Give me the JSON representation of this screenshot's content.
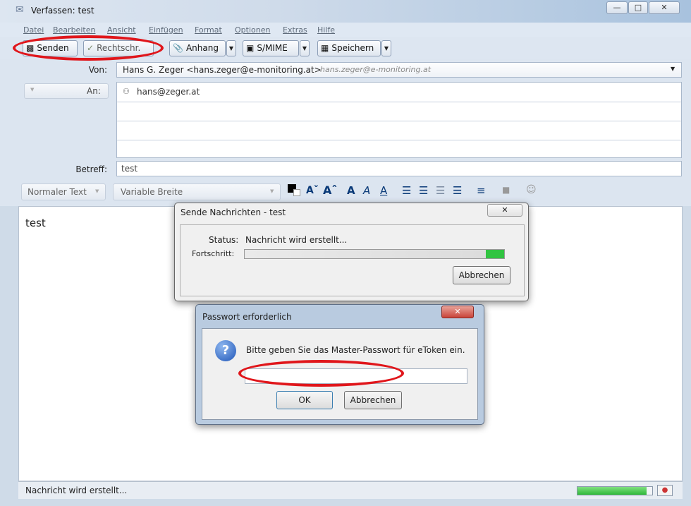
{
  "window": {
    "title": "Verfassen: test"
  },
  "menu": [
    "Datei",
    "Bearbeiten",
    "Ansicht",
    "Einfügen",
    "Format",
    "Optionen",
    "Extras",
    "Hilfe"
  ],
  "toolbar": {
    "send": "Senden",
    "spell": "Rechtschr.",
    "attach": "Anhang",
    "smime": "S/MIME",
    "save": "Speichern"
  },
  "header": {
    "from_label": "Von:",
    "from_value": "Hans G. Zeger <hans.zeger@e-monitoring.at>",
    "from_hint": "hans.zeger@e-monitoring.at",
    "to_label": "An:",
    "to_value": "hans@zeger.at",
    "subject_label": "Betreff:",
    "subject_value": "test"
  },
  "format": {
    "paragraph": "Normaler Text",
    "font": "Variable Breite"
  },
  "body_text": "test",
  "status": {
    "text": "Nachricht wird erstellt...",
    "progress": 0.92
  },
  "send_dialog": {
    "title": "Sende Nachrichten - test",
    "status_label": "Status:",
    "status_value": "Nachricht wird erstellt...",
    "progress_label": "Fortschritt:",
    "progress": 0.94,
    "cancel": "Abbrechen"
  },
  "pw_dialog": {
    "title": "Passwort erforderlich",
    "message": "Bitte geben Sie das Master-Passwort für eToken ein.",
    "ok": "OK",
    "cancel": "Abbrechen"
  },
  "colors": {
    "annotation": "#e0161b",
    "progress": "#31c441",
    "close": "#c9443a"
  }
}
